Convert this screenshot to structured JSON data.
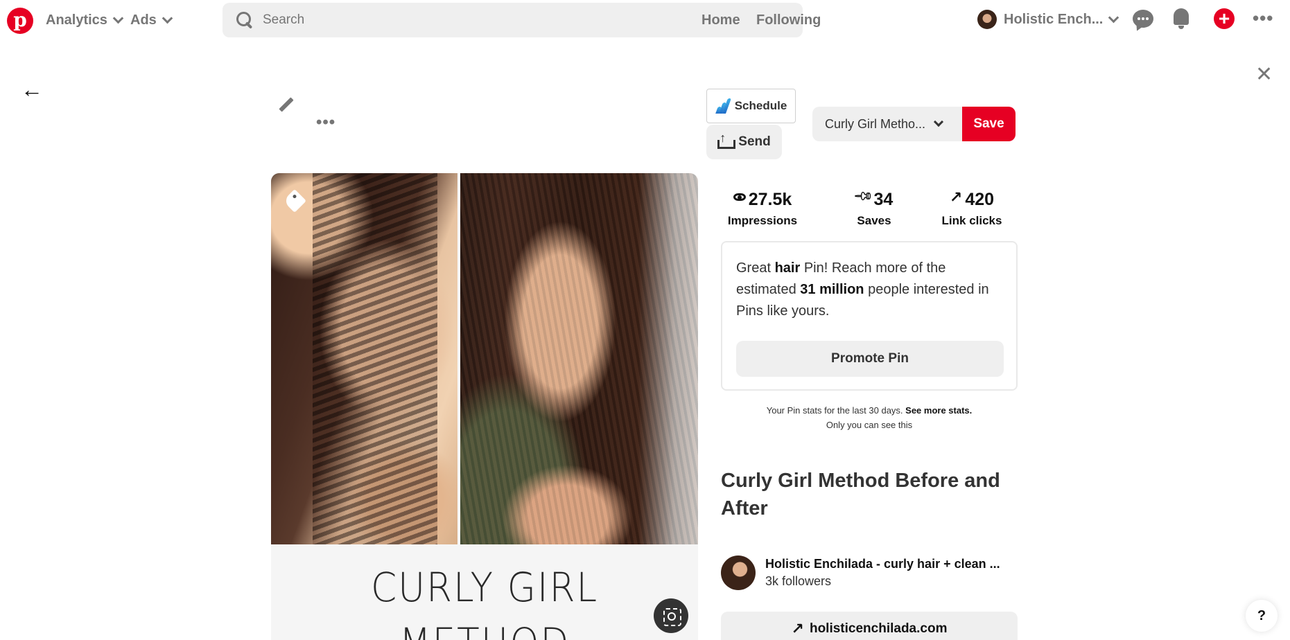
{
  "nav": {
    "logo_letter": "p",
    "analytics_label": "Analytics",
    "ads_label": "Ads",
    "search_placeholder": "Search",
    "home_label": "Home",
    "following_label": "Following",
    "profile_name": "Holistic Ench...",
    "more_label": "•••",
    "plus_label": "+"
  },
  "toolbar": {
    "more_label": "•••",
    "schedule_label": "Schedule",
    "send_label": "Send",
    "board_label": "Curly Girl Metho...",
    "save_label": "Save"
  },
  "pin_image": {
    "caption_line1": "CURLY GIRL",
    "caption_line2": "METHOD"
  },
  "stats": [
    {
      "value": "27.5k",
      "label": "Impressions",
      "icon": "eye-icon"
    },
    {
      "value": "34",
      "label": "Saves",
      "icon": "pushpin-icon"
    },
    {
      "value": "420",
      "label": "Link clicks",
      "icon": "arrow-up-right-icon"
    }
  ],
  "promo": {
    "text_1": "Great ",
    "text_bold_1": "hair",
    "text_2": " Pin! Reach more of the estimated ",
    "text_bold_2": "31 million",
    "text_3": " people interested in Pins like yours.",
    "button_label": "Promote Pin"
  },
  "stats_note": {
    "line1": "Your Pin stats for the last 30 days. ",
    "link": "See more stats.",
    "line2": "Only you can see this"
  },
  "pin": {
    "title": "Curly Girl Method Before and After"
  },
  "author": {
    "name": "Holistic Enchilada - curly hair + clean ...",
    "followers": "3k followers"
  },
  "website": {
    "label": "holisticenchilada.com"
  },
  "help_label": "?",
  "colors": {
    "brand": "#e60023",
    "button_gray": "#efefef",
    "icon_gray": "#767676"
  }
}
